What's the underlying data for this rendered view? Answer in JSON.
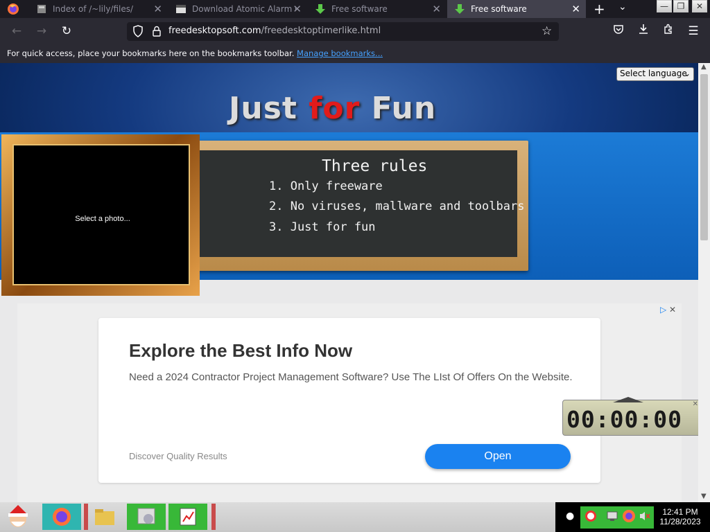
{
  "tabs": [
    {
      "title": "Index of /~lily/files/",
      "active": false
    },
    {
      "title": "Download Atomic Alarm Clock",
      "active": false
    },
    {
      "title": "Free software",
      "active": false
    },
    {
      "title": "Free software",
      "active": true
    }
  ],
  "address": {
    "domain": "freedesktopsoft.com",
    "path": "/freedesktoptimerlike.html"
  },
  "bookmarks_bar": {
    "message": "For quick access, place your bookmarks here on the bookmarks toolbar.",
    "link": "Manage bookmarks..."
  },
  "page": {
    "language_select": "Select language",
    "title_part1": "Just ",
    "title_part2": "for",
    "title_part3": " Fun",
    "board": {
      "title": "Three rules",
      "rules": [
        "1. Only freeware",
        "2. No viruses, mallware and toolbars",
        "3. Just for fun"
      ]
    },
    "photo_label": "Select a photo..."
  },
  "ad": {
    "title": "Explore the Best Info Now",
    "body": "Need a 2024 Contractor Project Management Software? Use The LIst Of Offers On the Website.",
    "footer": "Discover Quality Results",
    "button": "Open"
  },
  "timer": {
    "display": "00:00:00"
  },
  "taskbar": {
    "time": "12:41 PM",
    "date": "11/28/2023"
  },
  "colors": {
    "accent": "#1a82f0",
    "title_red": "#e11b1b",
    "browser_bg": "#1c1b22"
  }
}
